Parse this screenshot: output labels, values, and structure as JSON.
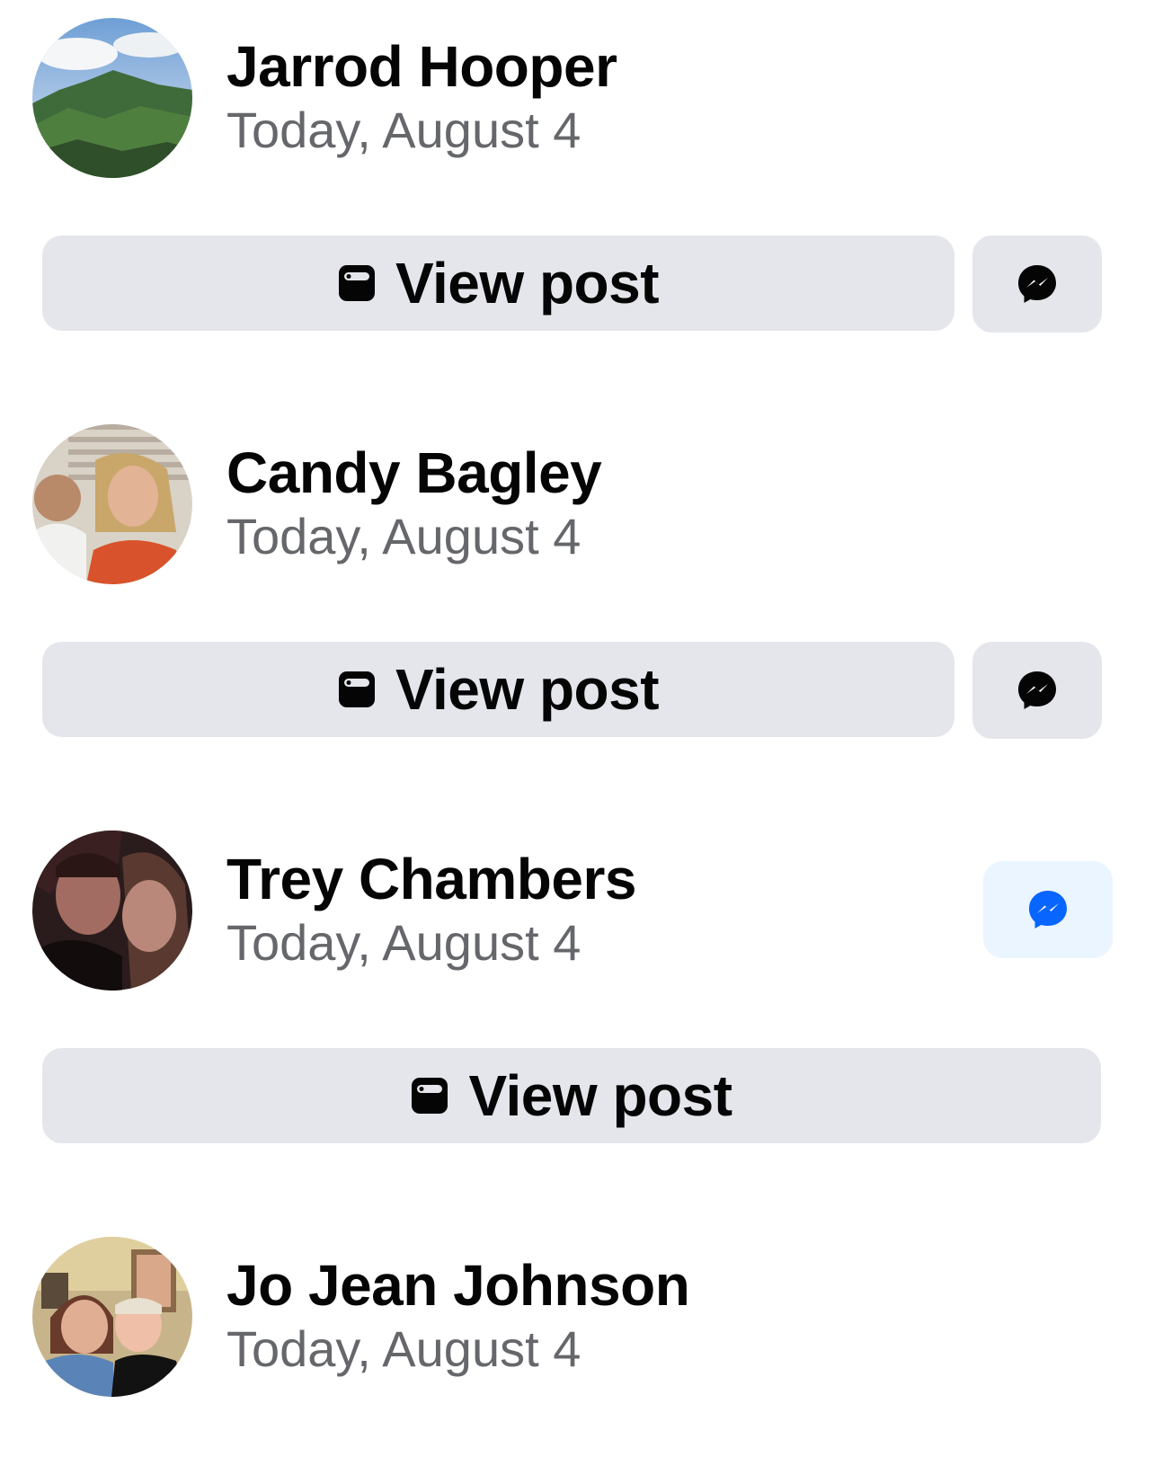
{
  "feed": {
    "entries": [
      {
        "name": "Jarrod Hooper",
        "date": "Today, August 4",
        "view_post_label": "View post",
        "message_style": "gray"
      },
      {
        "name": "Candy Bagley",
        "date": "Today, August 4",
        "view_post_label": "View post",
        "message_style": "gray"
      },
      {
        "name": "Trey Chambers",
        "date": "Today, August 4",
        "view_post_label": "View post",
        "message_style": "blue"
      },
      {
        "name": "Jo Jean Johnson",
        "date": "Today, August 4"
      }
    ]
  },
  "colors": {
    "button_bg": "#e4e6eb",
    "message_active_bg": "#ebf5ff",
    "messenger_blue": "#0866ff",
    "name_text": "#050505",
    "date_text": "#65676b"
  },
  "icons": {
    "view_post": "post-icon",
    "message": "messenger-icon"
  }
}
